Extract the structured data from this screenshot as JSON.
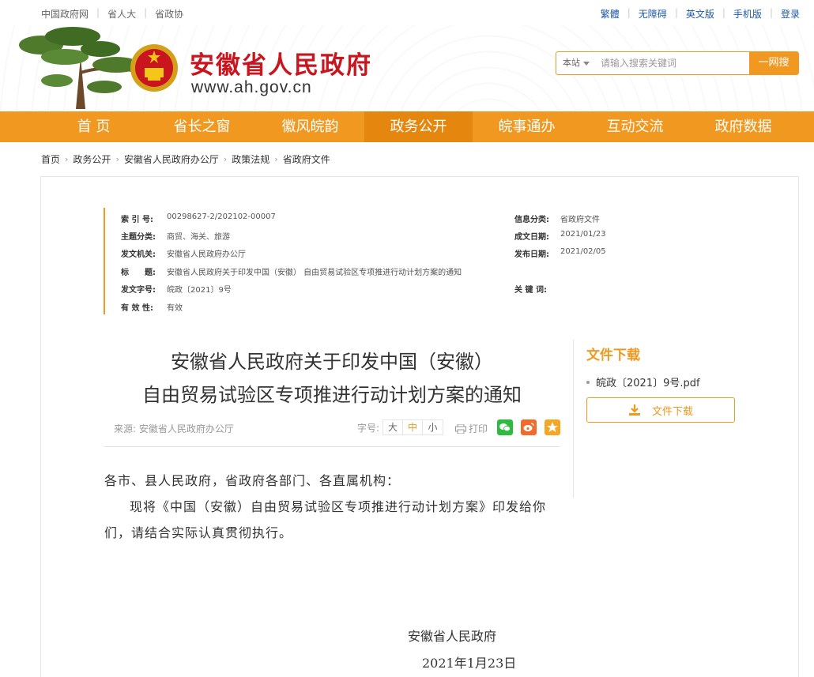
{
  "topbar": {
    "left_links": [
      "中国政府网",
      "省人大",
      "省政协"
    ],
    "right_links": [
      "繁體",
      "无障碍",
      "英文版",
      "手机版",
      "登录"
    ]
  },
  "header": {
    "site_name": "安徽省人民政府",
    "site_url": "www.ah.gov.cn",
    "search": {
      "scope": "本站",
      "placeholder": "请输入搜索关键词",
      "button": "一网搜"
    }
  },
  "nav": {
    "items": [
      "首 页",
      "省长之窗",
      "徽风皖韵",
      "政务公开",
      "皖事通办",
      "互动交流",
      "政府数据"
    ],
    "active_index": 3
  },
  "breadcrumb": [
    "首页",
    "政务公开",
    "安徽省人民政府办公厅",
    "政策法规",
    "省政府文件"
  ],
  "meta": {
    "index_no": {
      "label": "索 引 号:",
      "value": "00298627-2/202102-00007"
    },
    "category": {
      "label": "信息分类:",
      "value": "省政府文件"
    },
    "topic": {
      "label": "主题分类:",
      "value": "商贸、海关、旅游"
    },
    "written_date": {
      "label": "成文日期:",
      "value": "2021/01/23"
    },
    "issuer": {
      "label": "发文机关:",
      "value": "安徽省人民政府办公厅"
    },
    "publish_date": {
      "label": "发布日期:",
      "value": "2021/02/05"
    },
    "title": {
      "label": "标　　题:",
      "value": "安徽省人民政府关于印发中国（安徽） 自由贸易试验区专项推进行动计划方案的通知"
    },
    "doc_no": {
      "label": "发文字号:",
      "value": "皖政〔2021〕9号"
    },
    "keywords": {
      "label": "关 键 词:",
      "value": ""
    },
    "validity": {
      "label": "有 效 性:",
      "value": "有效"
    }
  },
  "article": {
    "title_line1": "安徽省人民政府关于印发中国（安徽）",
    "title_line2": "自由贸易试验区专项推进行动计划方案的通知",
    "source": "来源: 安徽省人民政府办公厅",
    "font_label": "字号:",
    "font_sizes": [
      "大",
      "中",
      "小"
    ],
    "font_active": "中",
    "print": "打印",
    "salutation": "各市、县人民政府，省政府各部门、各直属机构：",
    "paragraph": "现将《中国（安徽）自由贸易试验区专项推进行动计划方案》印发给你们，请结合实际认真贯彻执行。",
    "signature": "安徽省人民政府",
    "date": "2021年1月23日"
  },
  "sidebar": {
    "download_title": "文件下载",
    "file_name": "皖政〔2021〕9号.pdf",
    "download_button": "文件下载"
  },
  "colors": {
    "accent": "#f19820",
    "brand_red": "#c9151e",
    "link_blue": "#1f5aa8"
  }
}
